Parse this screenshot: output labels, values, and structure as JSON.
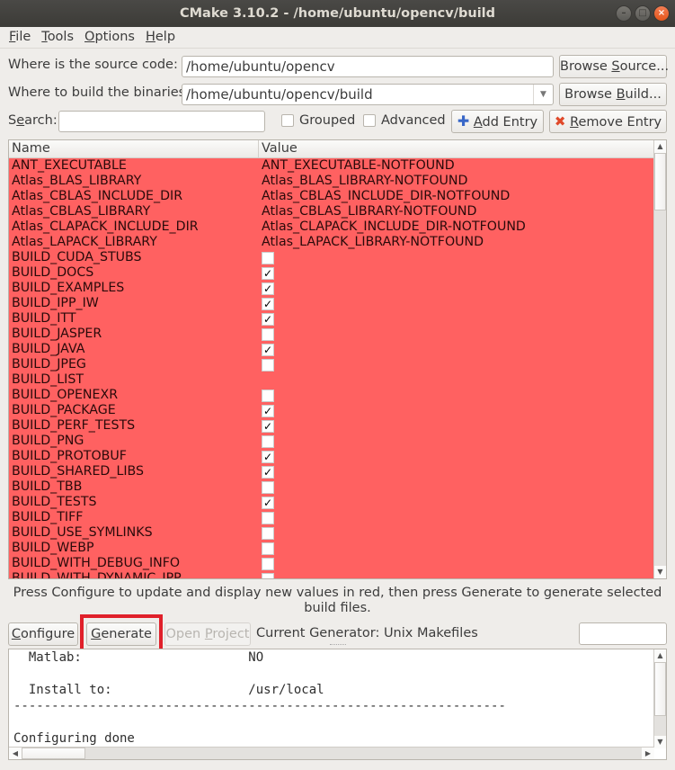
{
  "window": {
    "title": "CMake 3.10.2 - /home/ubuntu/opencv/build",
    "controls": [
      "minimize",
      "maximize",
      "close"
    ]
  },
  "menu": [
    {
      "mnemonic": "F",
      "rest": "ile"
    },
    {
      "mnemonic": "T",
      "rest": "ools"
    },
    {
      "mnemonic": "O",
      "rest": "ptions"
    },
    {
      "mnemonic": "H",
      "rest": "elp"
    }
  ],
  "source": {
    "label": "Where is the source code:",
    "value": "/home/ubuntu/opencv",
    "browse_pre": "Browse ",
    "browse_mn": "S",
    "browse_post": "ource..."
  },
  "build": {
    "label": "Where to build the binaries:",
    "value": "/home/ubuntu/opencv/build",
    "browse_pre": "Browse ",
    "browse_mn": "B",
    "browse_post": "uild..."
  },
  "search": {
    "label_pre": "S",
    "label_mn": "e",
    "label_post": "arch:",
    "value": "",
    "grouped_label": "Grouped",
    "grouped_checked": false,
    "advanced_label": "Advanced",
    "advanced_checked": false,
    "add_entry_mn": "A",
    "add_entry_rest": "dd Entry",
    "remove_entry_mn": "R",
    "remove_entry_rest": "emove Entry"
  },
  "table": {
    "columns": [
      "Name",
      "Value"
    ],
    "highlight_color": "#ff6161",
    "rows": [
      {
        "name": "ANT_EXECUTABLE",
        "type": "text",
        "value": "ANT_EXECUTABLE-NOTFOUND"
      },
      {
        "name": "Atlas_BLAS_LIBRARY",
        "type": "text",
        "value": "Atlas_BLAS_LIBRARY-NOTFOUND"
      },
      {
        "name": "Atlas_CBLAS_INCLUDE_DIR",
        "type": "text",
        "value": "Atlas_CBLAS_INCLUDE_DIR-NOTFOUND"
      },
      {
        "name": "Atlas_CBLAS_LIBRARY",
        "type": "text",
        "value": "Atlas_CBLAS_LIBRARY-NOTFOUND"
      },
      {
        "name": "Atlas_CLAPACK_INCLUDE_DIR",
        "type": "text",
        "value": "Atlas_CLAPACK_INCLUDE_DIR-NOTFOUND"
      },
      {
        "name": "Atlas_LAPACK_LIBRARY",
        "type": "text",
        "value": "Atlas_LAPACK_LIBRARY-NOTFOUND"
      },
      {
        "name": "BUILD_CUDA_STUBS",
        "type": "bool",
        "value": false
      },
      {
        "name": "BUILD_DOCS",
        "type": "bool",
        "value": true
      },
      {
        "name": "BUILD_EXAMPLES",
        "type": "bool",
        "value": true
      },
      {
        "name": "BUILD_IPP_IW",
        "type": "bool",
        "value": true
      },
      {
        "name": "BUILD_ITT",
        "type": "bool",
        "value": true
      },
      {
        "name": "BUILD_JASPER",
        "type": "bool",
        "value": false
      },
      {
        "name": "BUILD_JAVA",
        "type": "bool",
        "value": true
      },
      {
        "name": "BUILD_JPEG",
        "type": "bool",
        "value": false
      },
      {
        "name": "BUILD_LIST",
        "type": "text",
        "value": ""
      },
      {
        "name": "BUILD_OPENEXR",
        "type": "bool",
        "value": false
      },
      {
        "name": "BUILD_PACKAGE",
        "type": "bool",
        "value": true
      },
      {
        "name": "BUILD_PERF_TESTS",
        "type": "bool",
        "value": true
      },
      {
        "name": "BUILD_PNG",
        "type": "bool",
        "value": false
      },
      {
        "name": "BUILD_PROTOBUF",
        "type": "bool",
        "value": true
      },
      {
        "name": "BUILD_SHARED_LIBS",
        "type": "bool",
        "value": true
      },
      {
        "name": "BUILD_TBB",
        "type": "bool",
        "value": false
      },
      {
        "name": "BUILD_TESTS",
        "type": "bool",
        "value": true
      },
      {
        "name": "BUILD_TIFF",
        "type": "bool",
        "value": false
      },
      {
        "name": "BUILD_USE_SYMLINKS",
        "type": "bool",
        "value": false
      },
      {
        "name": "BUILD_WEBP",
        "type": "bool",
        "value": false
      },
      {
        "name": "BUILD_WITH_DEBUG_INFO",
        "type": "bool",
        "value": false
      },
      {
        "name": "BUILD_WITH_DYNAMIC_IPP",
        "type": "bool",
        "value": false
      }
    ]
  },
  "hint": "Press Configure to update and display new values in red, then press Generate to generate selected build files.",
  "actions": {
    "configure_mn": "C",
    "configure_rest": "onfigure",
    "generate_mn": "G",
    "generate_rest": "enerate",
    "open_project_pre": "Open ",
    "open_project_mn": "P",
    "open_project_post": "roject",
    "open_project_enabled": false,
    "current_generator": "Current Generator: Unix Makefiles",
    "highlighted": "generate",
    "highlight_color": "#e0202a"
  },
  "output": {
    "lines": [
      "  Matlab:                      NO",
      "",
      "  Install to:                  /usr/local",
      "-----------------------------------------------------------------",
      "",
      "Configuring done"
    ]
  }
}
